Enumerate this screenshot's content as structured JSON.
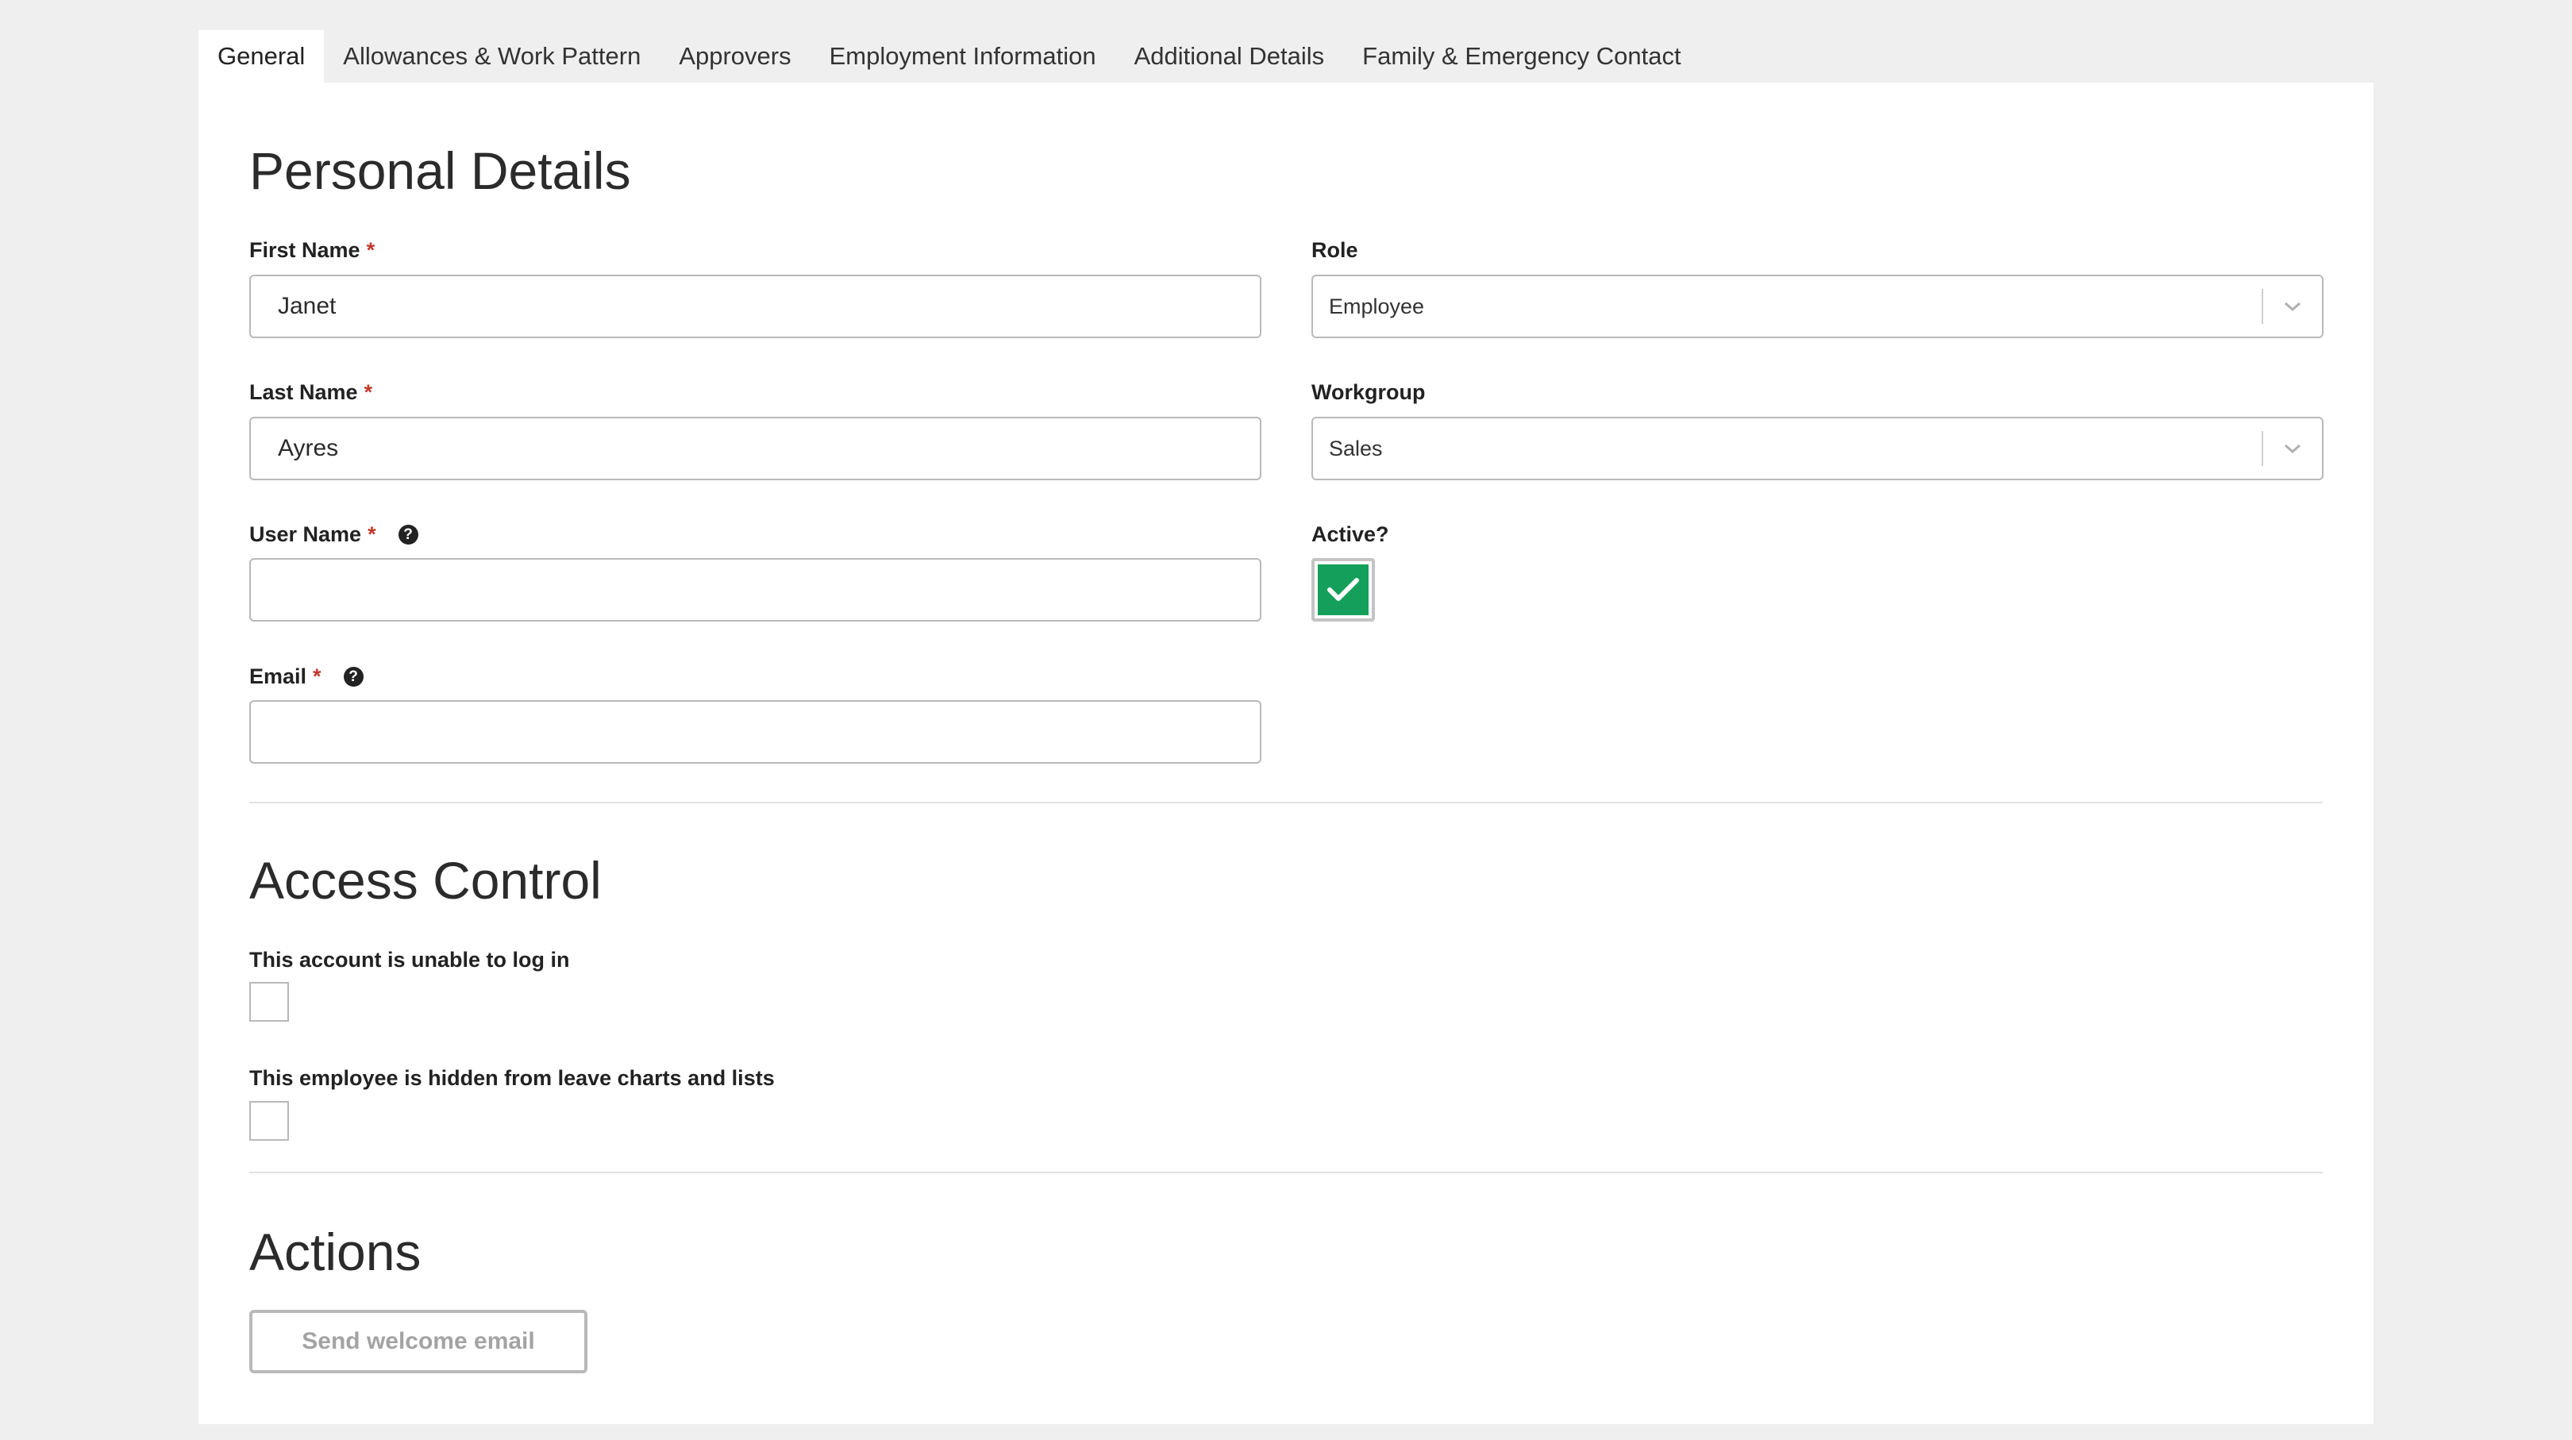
{
  "tabs": [
    {
      "label": "General",
      "active": true
    },
    {
      "label": "Allowances & Work Pattern"
    },
    {
      "label": "Approvers"
    },
    {
      "label": "Employment Information"
    },
    {
      "label": "Additional Details"
    },
    {
      "label": "Family & Emergency Contact"
    }
  ],
  "personal_details": {
    "heading": "Personal Details",
    "required_marker": "*",
    "first_name": {
      "label": "First Name",
      "value": "Janet"
    },
    "last_name": {
      "label": "Last Name",
      "value": "Ayres"
    },
    "user_name": {
      "label": "User Name",
      "value": "",
      "help_icon": "question-circle-icon"
    },
    "email": {
      "label": "Email",
      "value": "",
      "help_icon": "question-circle-icon"
    },
    "role": {
      "label": "Role",
      "selected": "Employee"
    },
    "workgroup": {
      "label": "Workgroup",
      "selected": "Sales"
    },
    "active": {
      "label": "Active?",
      "checked": true,
      "color": "#14a05a"
    }
  },
  "access_control": {
    "heading": "Access Control",
    "unable_to_login": {
      "label": "This account is unable to log in",
      "checked": false
    },
    "hidden_from_charts": {
      "label": "This employee is hidden from leave charts and lists",
      "checked": false
    }
  },
  "actions": {
    "heading": "Actions",
    "send_welcome_email": "Send welcome email"
  }
}
